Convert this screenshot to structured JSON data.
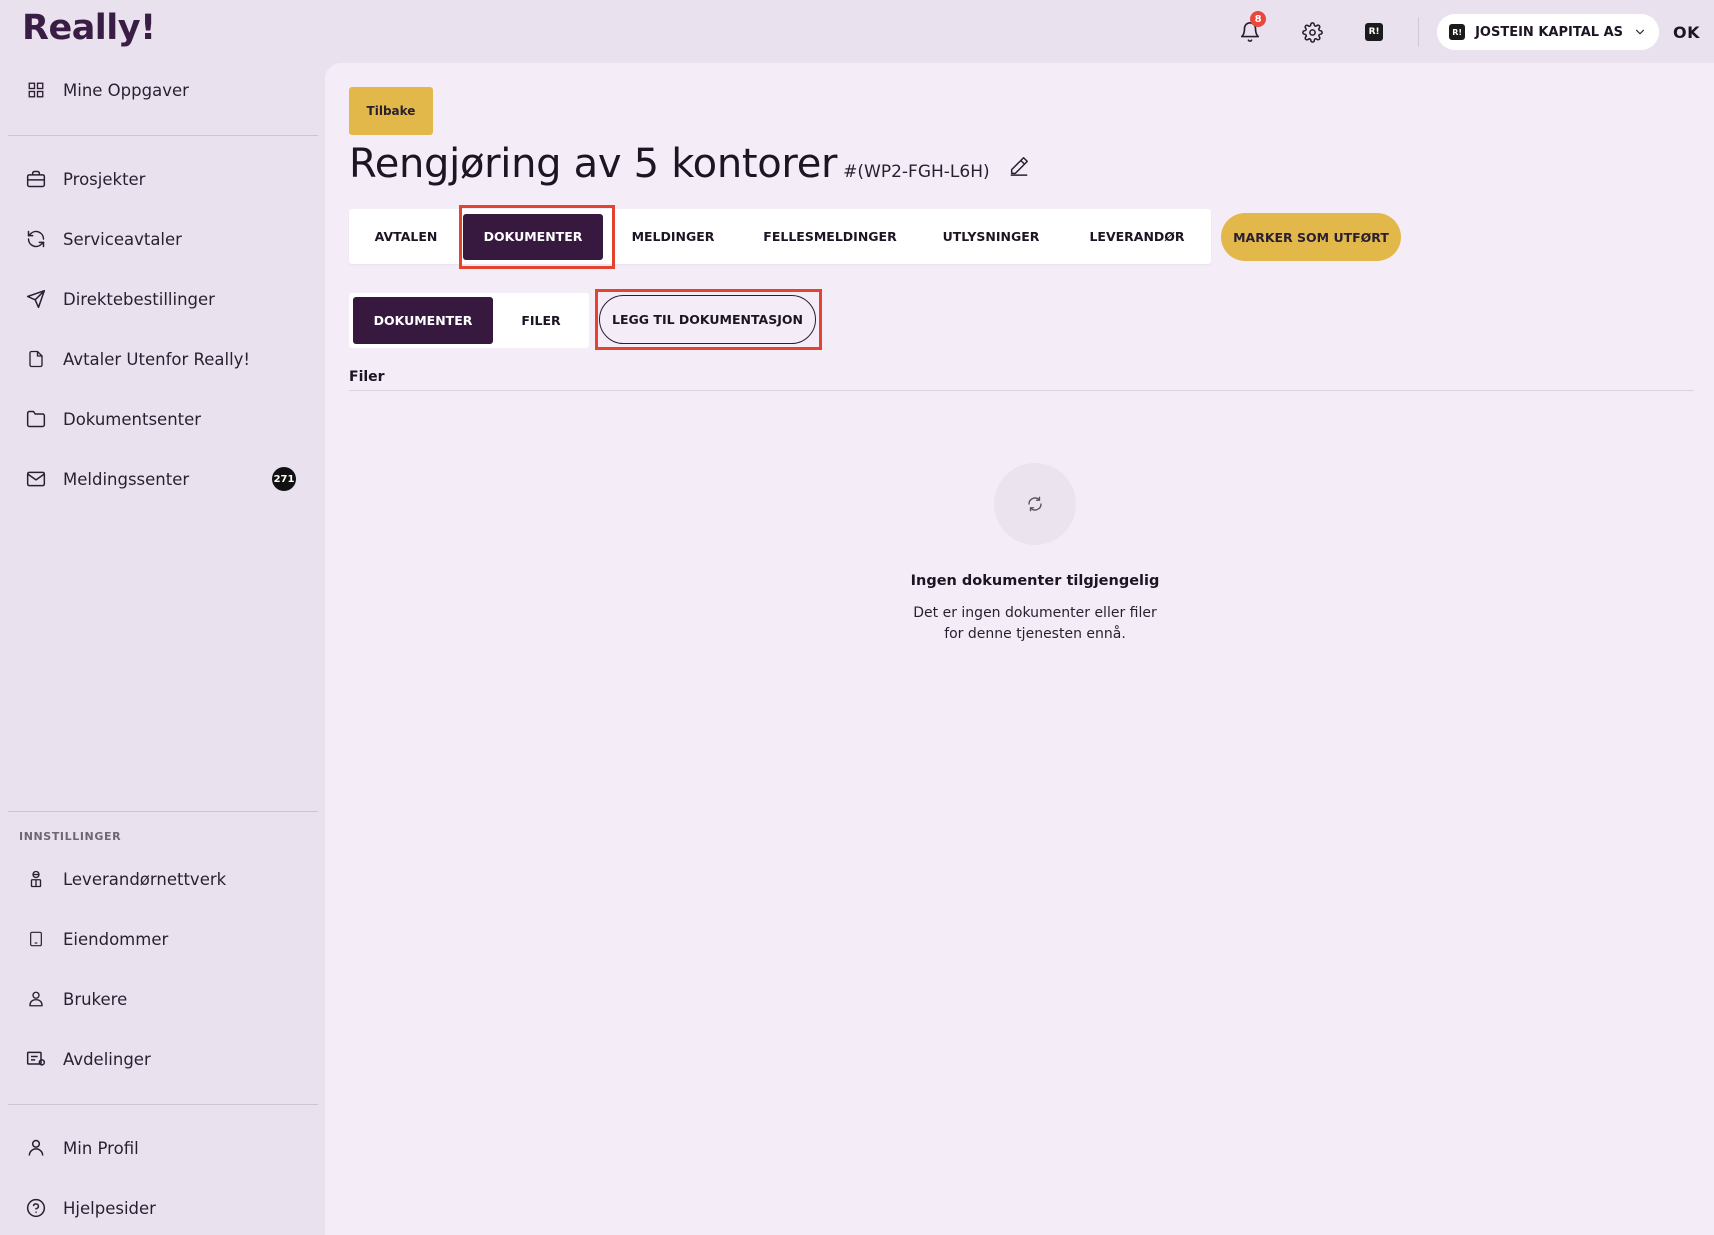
{
  "app": {
    "logo": "Really!"
  },
  "header": {
    "notifications_count": "8",
    "brand_badge": "R!",
    "company_name": "JOSTEIN KAPITAL AS",
    "user_initials": "OK"
  },
  "sidebar": {
    "main_items": [
      {
        "label": "Mine Oppgaver",
        "icon": "grid-icon"
      },
      {
        "label": "Prosjekter",
        "icon": "briefcase-icon"
      },
      {
        "label": "Serviceavtaler",
        "icon": "refresh-icon"
      },
      {
        "label": "Direktebestillinger",
        "icon": "send-icon"
      },
      {
        "label": "Avtaler Utenfor Really!",
        "icon": "document-icon"
      },
      {
        "label": "Dokumentsenter",
        "icon": "folder-icon"
      },
      {
        "label": "Meldingssenter",
        "icon": "mail-icon",
        "badge": "271"
      }
    ],
    "settings_title": "INNSTILLINGER",
    "settings_items": [
      {
        "label": "Leverandørnettverk",
        "icon": "supplier-icon"
      },
      {
        "label": "Eiendommer",
        "icon": "building-icon"
      },
      {
        "label": "Brukere",
        "icon": "user-icon"
      },
      {
        "label": "Avdelinger",
        "icon": "departments-icon"
      }
    ],
    "bottom_items": [
      {
        "label": "Min Profil",
        "icon": "profile-icon"
      },
      {
        "label": "Hjelpesider",
        "icon": "help-icon"
      }
    ]
  },
  "main": {
    "back_label": "Tilbake",
    "title": "Rengjøring av 5 kontorer",
    "id": "#(WP2-FGH-L6H)",
    "tabs": [
      {
        "label": "AVTALEN",
        "active": false
      },
      {
        "label": "DOKUMENTER",
        "active": true
      },
      {
        "label": "MELDINGER",
        "active": false
      },
      {
        "label": "FELLESMELDINGER",
        "active": false
      },
      {
        "label": "UTLYSNINGER",
        "active": false
      },
      {
        "label": "LEVERANDØR",
        "active": false
      }
    ],
    "done_label": "MARKER SOM UTFØRT",
    "subtabs": [
      {
        "label": "DOKUMENTER",
        "active": true
      },
      {
        "label": "FILER",
        "active": false
      }
    ],
    "add_doc_label": "LEGG TIL DOKUMENTASJON",
    "files_label": "Filer",
    "empty_title": "Ingen dokumenter tilgjengelig",
    "empty_desc": "Det er ingen dokumenter eller filer for denne tjenesten ennå."
  },
  "colors": {
    "brand_dark": "#37193f",
    "accent_gold": "#e3b84a",
    "highlight_red": "#e2442f",
    "sidebar_bg": "#eae1ef",
    "panel_bg": "#f4edf7"
  }
}
